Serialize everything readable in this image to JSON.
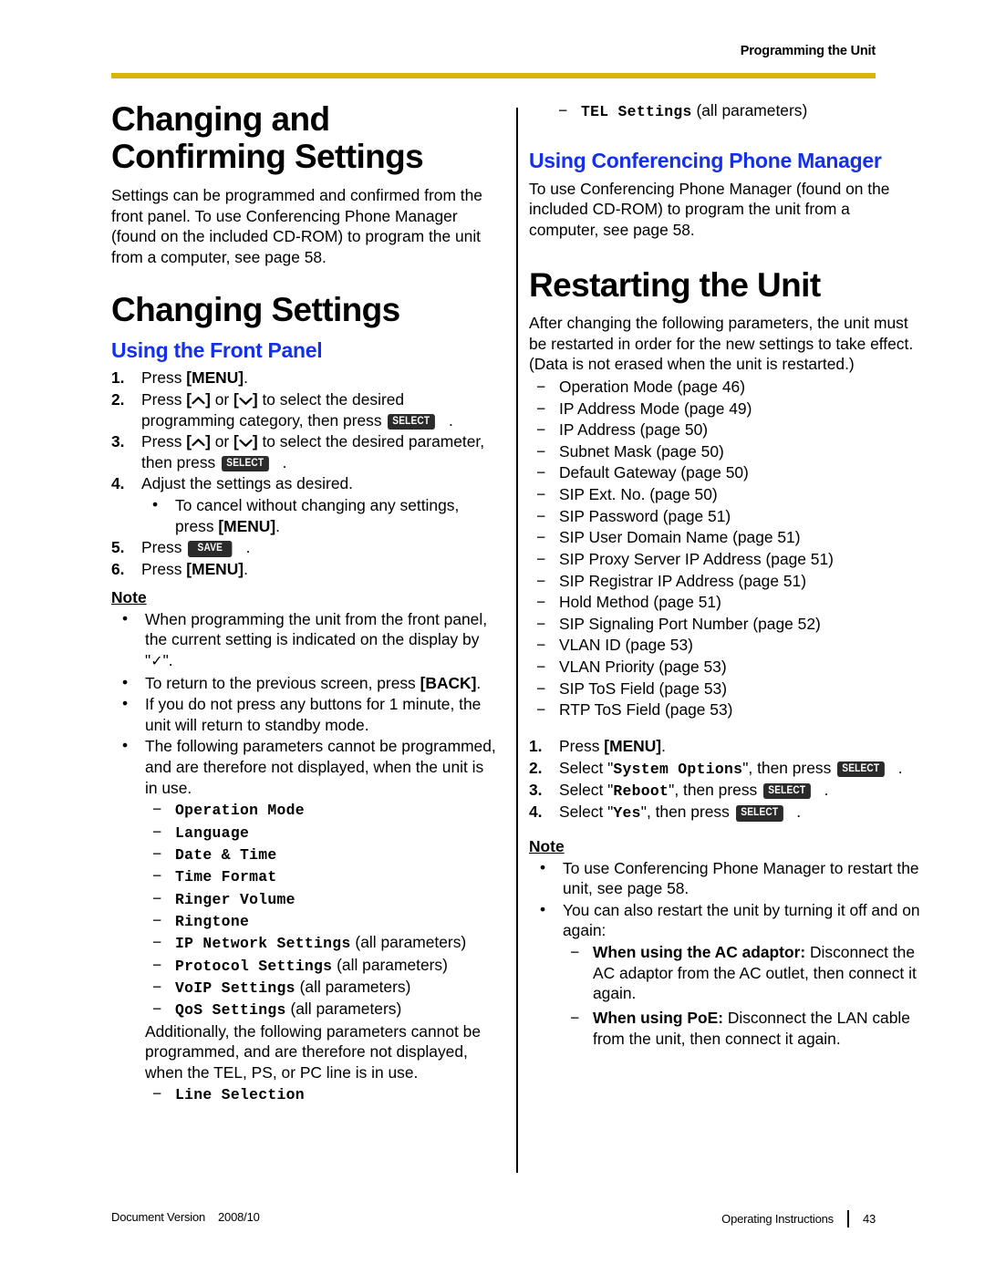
{
  "header": {
    "title": "Programming the Unit",
    "rule_color": "#d9b40b"
  },
  "left_column": {
    "section1_title_line1": "Changing and",
    "section1_title_line2": "Confirming Settings",
    "section1_body": "Settings can be programmed and confirmed from the front panel. To use Conferencing Phone Manager (found on the included CD-ROM) to program the unit from a computer, see page 58.",
    "section2_title": "Changing Settings",
    "section2_subtitle": "Using the Front Panel",
    "steps": [
      {
        "num": "1.",
        "pre": "Press ",
        "bold": "[MENU]",
        "post": "."
      },
      {
        "num": "2.",
        "pre": "Press ",
        "mid": " or ",
        "post": " to select the desired programming category, then press ",
        "chip": "SELECT",
        "end": "."
      },
      {
        "num": "3.",
        "pre": "Press ",
        "mid": " or ",
        "post": " to select the desired parameter, then press ",
        "chip": "SELECT",
        "end": "."
      },
      {
        "num": "4.",
        "pre": "Adjust the settings as desired."
      },
      {
        "num": "5.",
        "pre": "Press ",
        "chip": "SAVE",
        "end": "."
      },
      {
        "num": "6.",
        "pre": "Press ",
        "bold": "[MENU]",
        "post": "."
      }
    ],
    "step4_sub_bullet_pre": "To cancel without changing any settings, press ",
    "step4_sub_bullet_bold": "[MENU]",
    "step4_sub_bullet_post": ".",
    "note_label": "Note",
    "note_bullets": [
      {
        "text_pre": "When programming the unit from the front panel, the current setting is indicated on the display by \"",
        "check": "✓",
        "text_post": "\"."
      },
      {
        "text_pre": "To return to the previous screen, press ",
        "bold": "[BACK]",
        "text_post": "."
      },
      {
        "text_pre": "If you do not press any buttons for 1 minute, the unit will return to standby mode."
      },
      {
        "text_pre": "The following parameters cannot be programmed, and are therefore not displayed, when the unit is in use."
      }
    ],
    "param_list": [
      {
        "mono": "Operation Mode",
        "plain": ""
      },
      {
        "mono": "Language",
        "plain": ""
      },
      {
        "mono": "Date & Time",
        "plain": ""
      },
      {
        "mono": "Time Format",
        "plain": ""
      },
      {
        "mono": "Ringer Volume",
        "plain": ""
      },
      {
        "mono": "Ringtone",
        "plain": ""
      },
      {
        "mono": "IP Network Settings",
        "plain": " (all parameters)"
      },
      {
        "mono": "Protocol Settings",
        "plain": " (all parameters)"
      },
      {
        "mono": "VoIP Settings",
        "plain": " (all parameters)"
      },
      {
        "mono": "QoS Settings",
        "plain": " (all parameters)"
      }
    ],
    "additional_paragraph": "Additionally, the following parameters cannot be programmed, and are therefore not displayed, when the TEL, PS, or PC line is in use.",
    "param_list2": [
      {
        "mono": "Line Selection",
        "plain": ""
      }
    ]
  },
  "right_column": {
    "continued_param": {
      "mono": "TEL Settings",
      "plain": " (all parameters)"
    },
    "section3_subtitle": "Using Conferencing Phone Manager",
    "section3_body": "To use Conferencing Phone Manager (found on the included CD-ROM) to program the unit from a computer, see page 58.",
    "section4_title": "Restarting the Unit",
    "section4_body": "After changing the following parameters, the unit must be restarted in order for the new settings to take effect. (Data is not erased when the unit is restarted.)",
    "restart_params": [
      "Operation Mode (page 46)",
      "IP Address Mode (page 49)",
      "IP Address (page 50)",
      "Subnet Mask (page 50)",
      "Default Gateway (page 50)",
      "SIP Ext. No. (page 50)",
      "SIP Password (page 51)",
      "SIP User Domain Name (page 51)",
      "SIP Proxy Server IP Address (page 51)",
      "SIP Registrar IP Address (page 51)",
      "Hold Method (page 51)",
      "SIP Signaling Port Number (page 52)",
      "VLAN ID (page 53)",
      "VLAN Priority (page 53)",
      "SIP ToS Field (page 53)",
      "RTP ToS Field (page 53)"
    ],
    "steps": [
      {
        "num": "1.",
        "pre": "Press ",
        "bold": "[MENU]",
        "post": "."
      },
      {
        "num": "2.",
        "pre": "Select \"",
        "mono": "System Options",
        "mid": "\", then press ",
        "chip": "SELECT",
        "end": "."
      },
      {
        "num": "3.",
        "pre": "Select \"",
        "mono": "Reboot",
        "mid": "\", then press ",
        "chip": "SELECT",
        "end": "."
      },
      {
        "num": "4.",
        "pre": "Select \"",
        "mono": "Yes",
        "mid": "\", then press ",
        "chip": "SELECT",
        "end": "."
      }
    ],
    "note_label": "Note",
    "note_bullets": [
      {
        "text": "To use Conferencing Phone Manager to restart the unit, see page 58."
      },
      {
        "text": "You can also restart the unit by turning it off and on again:"
      }
    ],
    "restart_methods": [
      {
        "bold": "When using the AC adaptor:",
        "plain": " Disconnect the AC adaptor from the AC outlet, then connect it again."
      },
      {
        "bold": "When using PoE:",
        "plain": " Disconnect the LAN cable from the unit, then connect it again."
      }
    ]
  },
  "footer": {
    "doc_version_label": "Document Version",
    "doc_version_value": "2008/10",
    "right_label": "Operating Instructions",
    "page_number": "43"
  }
}
